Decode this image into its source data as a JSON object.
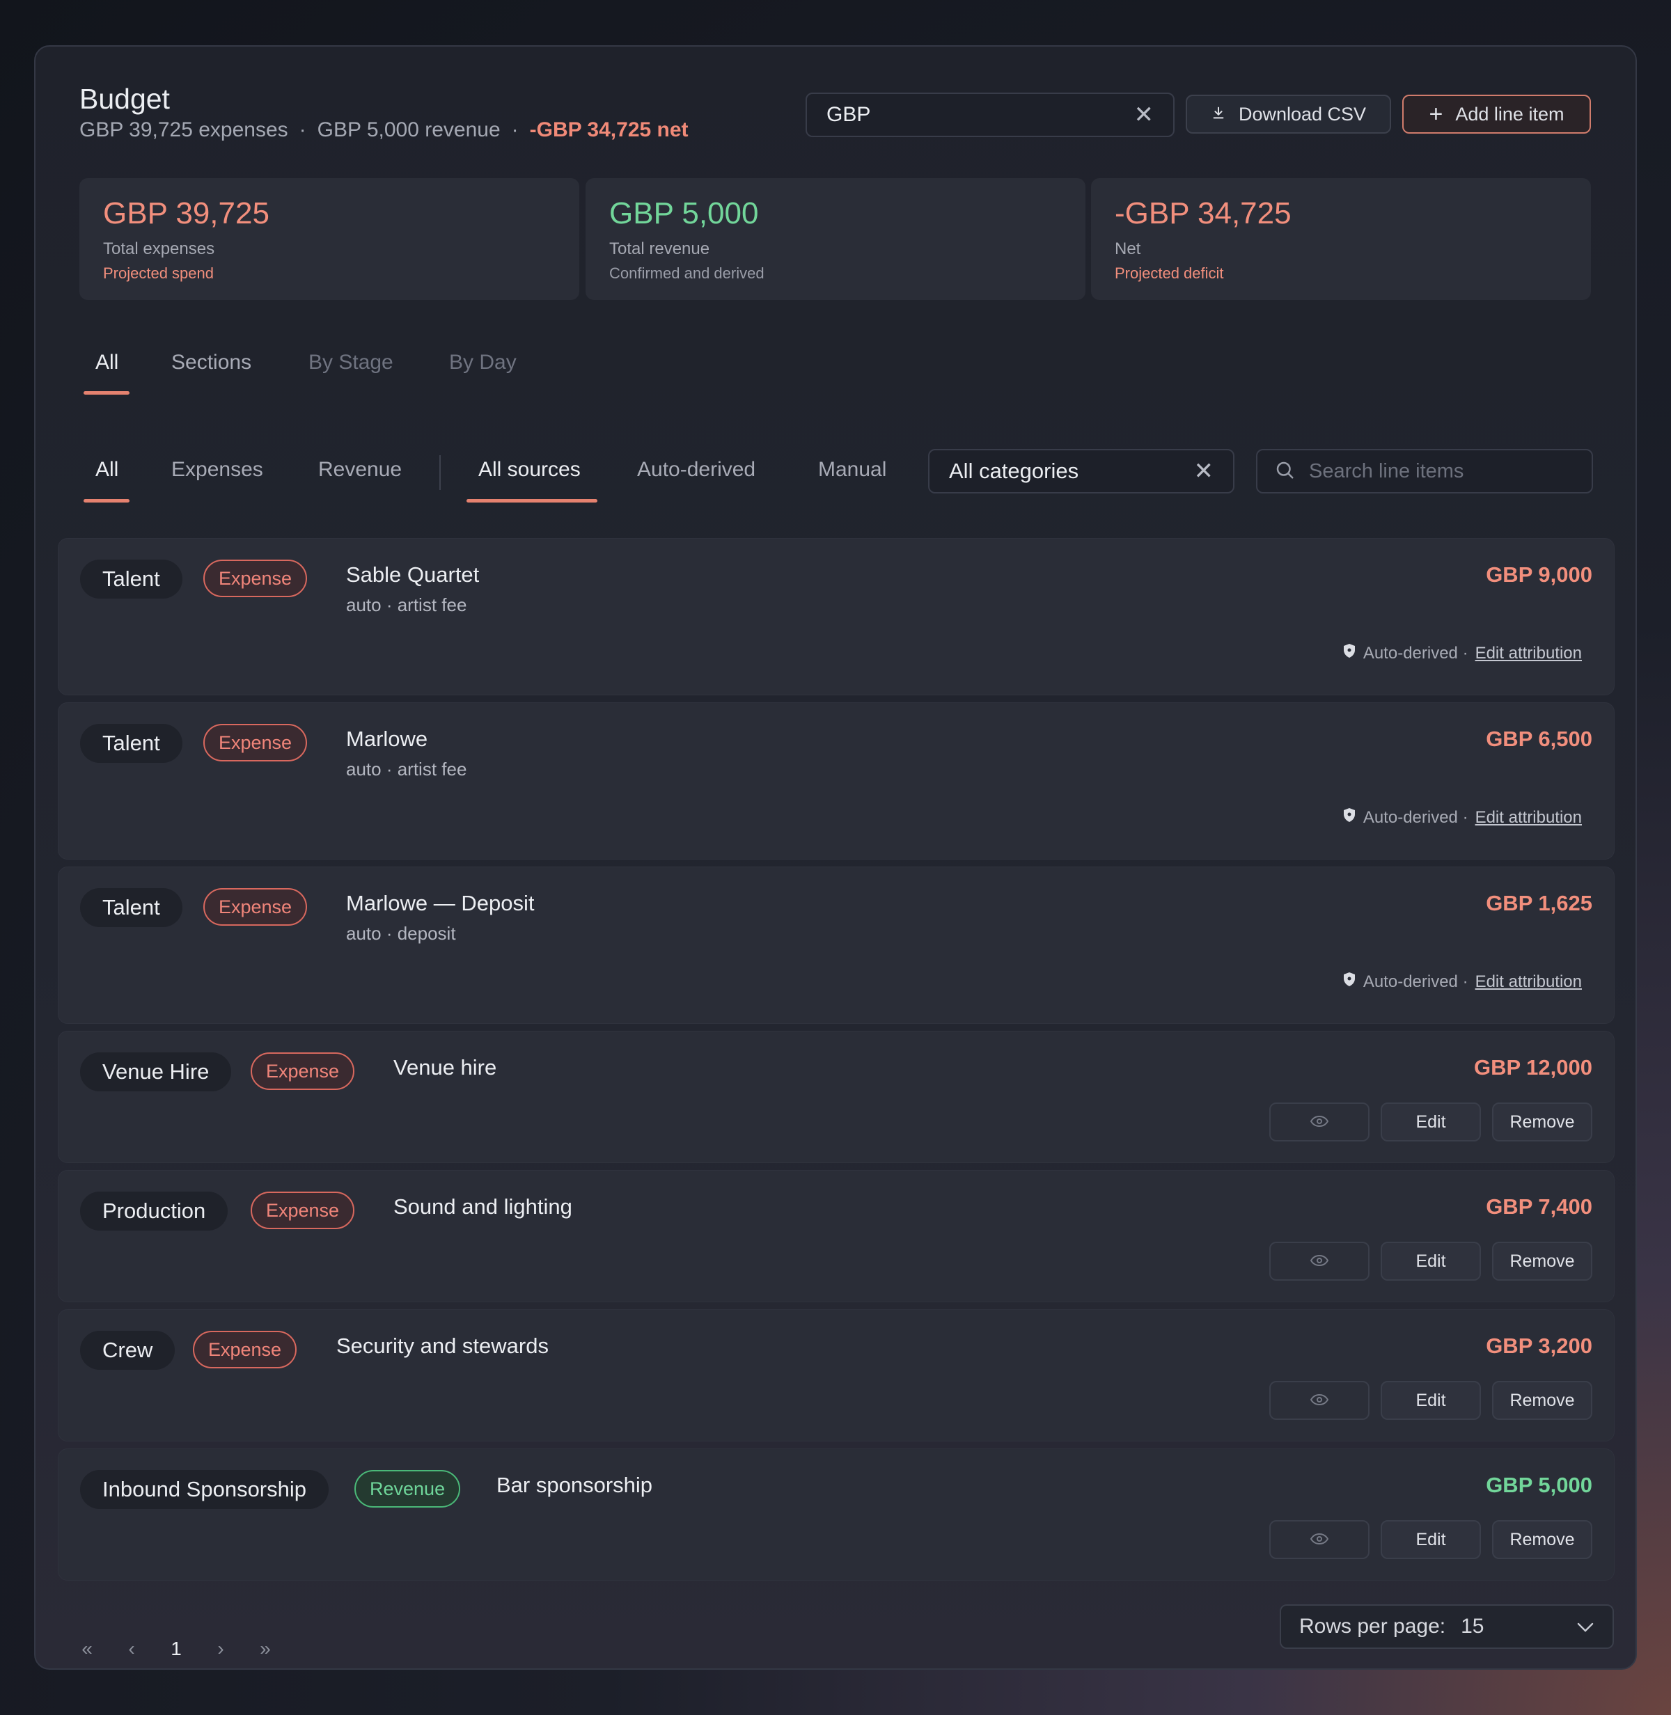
{
  "header": {
    "title": "Budget",
    "summary_expenses": "GBP 39,725 expenses",
    "summary_revenue": "GBP 5,000 revenue",
    "summary_net": "-GBP 34,725 net",
    "separator": "·"
  },
  "currency": {
    "value": "GBP"
  },
  "toolbar": {
    "download_label": "Download CSV",
    "add_label": "Add line item"
  },
  "stats": [
    {
      "value": "GBP 39,725",
      "label": "Total expenses",
      "sub": "Projected spend"
    },
    {
      "value": "GBP 5,000",
      "label": "Total revenue",
      "sub": "Confirmed and derived"
    },
    {
      "value": "-GBP 34,725",
      "label": "Net",
      "sub": "Projected deficit"
    }
  ],
  "view_tabs": [
    "All",
    "Sections",
    "By Stage",
    "By Day"
  ],
  "type_tabs": [
    "All",
    "Expenses",
    "Revenue"
  ],
  "source_tabs": [
    "All sources",
    "Auto-derived",
    "Manual"
  ],
  "category_filter": {
    "value": "All categories"
  },
  "search": {
    "placeholder": "Search line items"
  },
  "rows": [
    {
      "category": "Talent",
      "type": "Expense",
      "name": "Sable Quartet",
      "meta": "auto · artist fee",
      "amount": "GBP 9,000",
      "attr_text": "Auto-derived ·",
      "attr_link": "Edit attribution"
    },
    {
      "category": "Talent",
      "type": "Expense",
      "name": "Marlowe",
      "meta": "auto · artist fee",
      "amount": "GBP 6,500",
      "attr_text": "Auto-derived ·",
      "attr_link": "Edit attribution"
    },
    {
      "category": "Talent",
      "type": "Expense",
      "name": "Marlowe — Deposit",
      "meta": "auto · deposit",
      "amount": "GBP 1,625",
      "attr_text": "Auto-derived ·",
      "attr_link": "Edit attribution"
    },
    {
      "category": "Venue Hire",
      "type": "Expense",
      "name": "Venue hire",
      "amount": "GBP 12,000",
      "edit": "Edit",
      "remove": "Remove"
    },
    {
      "category": "Production",
      "type": "Expense",
      "name": "Sound and lighting",
      "amount": "GBP 7,400",
      "edit": "Edit",
      "remove": "Remove"
    },
    {
      "category": "Crew",
      "type": "Expense",
      "name": "Security and stewards",
      "amount": "GBP 3,200",
      "edit": "Edit",
      "remove": "Remove"
    },
    {
      "category": "Inbound Sponsorship",
      "type": "Revenue",
      "name": "Bar sponsorship",
      "amount": "GBP 5,000",
      "edit": "Edit",
      "remove": "Remove"
    }
  ],
  "pagination": {
    "first": "«",
    "prev": "‹",
    "page": "1",
    "next": "›",
    "last": "»"
  },
  "rows_per_page": {
    "label": "Rows per page:",
    "value": "15"
  },
  "colors": {
    "accent": "#e5826f",
    "expense": "#f0857a",
    "revenue": "#6fd69a"
  },
  "icons": [
    "close-icon",
    "download-icon",
    "plus-icon",
    "search-icon",
    "shield-icon",
    "eye-icon",
    "chevron-down-icon"
  ]
}
